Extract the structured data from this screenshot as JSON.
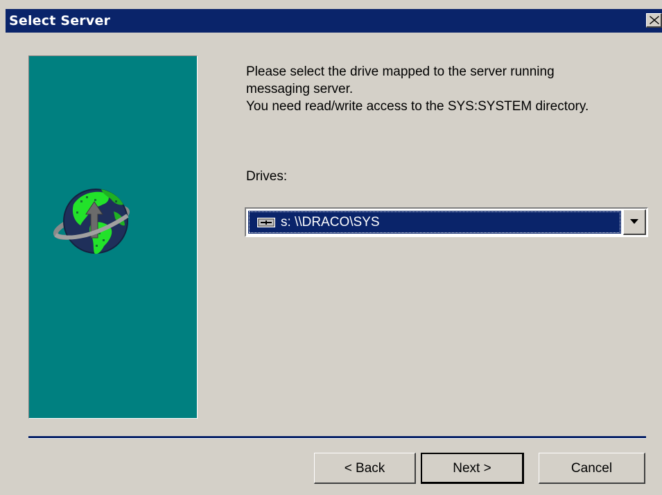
{
  "window": {
    "title": "Select Server",
    "close_icon": "close-x-icon"
  },
  "side_panel": {
    "image": "globe-network-icon",
    "background_color": "#008080"
  },
  "main": {
    "instructions": [
      "Please select the drive mapped to the server running",
      "messaging server.",
      "You need read/write access to the SYS:SYSTEM directory."
    ],
    "drives_label": "Drives:",
    "drives_select": {
      "selected_value": "s: \\\\DRACO\\SYS",
      "icon": "network-drive-icon",
      "dropdown_icon": "chevron-down-icon"
    }
  },
  "buttons": {
    "back_label": "< Back",
    "next_label": "Next >",
    "cancel_label": "Cancel"
  },
  "colors": {
    "titlebar": "#0a246a",
    "dialog_face": "#d4d0c8",
    "selection": "#0a246a"
  }
}
